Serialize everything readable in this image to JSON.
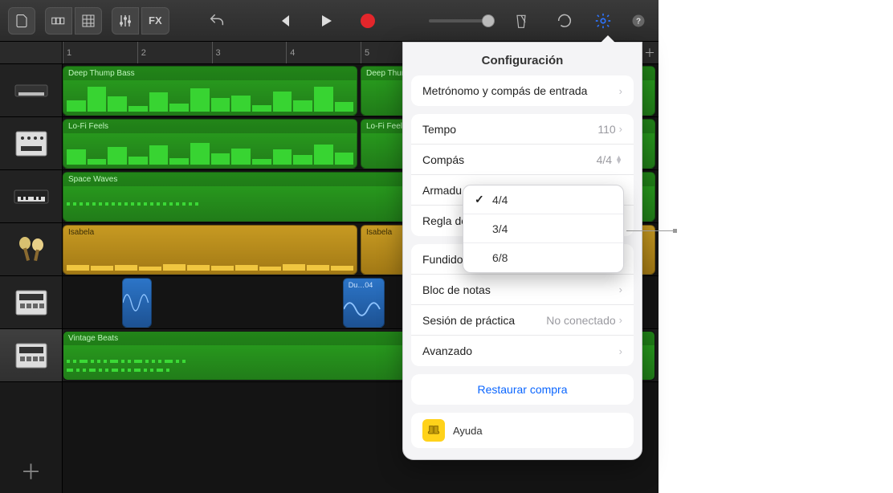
{
  "toolbar": {
    "fx_label": "FX"
  },
  "ruler": {
    "marks": [
      "1",
      "2",
      "3",
      "4",
      "5"
    ]
  },
  "tracks": [
    {
      "name": "Deep Thump Bass",
      "type": "midi-green"
    },
    {
      "name": "Lo-Fi Feels",
      "type": "midi-green"
    },
    {
      "name": "Space Waves",
      "type": "dots-green"
    },
    {
      "name": "Isabela",
      "type": "midi-olive"
    },
    {
      "name": "Du…04",
      "type": "audio-blue"
    },
    {
      "name": "Vintage Beats",
      "type": "dots-green"
    }
  ],
  "popover": {
    "title": "Configuración",
    "metronome": "Metrónomo y compás de entrada",
    "tempo_label": "Tempo",
    "tempo_value": "110",
    "compas_label": "Compás",
    "compas_value": "4/4",
    "armadura_label": "Armadu",
    "regla_label": "Regla de",
    "fundido_label": "Fundido de salida",
    "bloc_label": "Bloc de notas",
    "sesion_label": "Sesión de práctica",
    "sesion_value": "No conectado",
    "avanzado_label": "Avanzado",
    "restore": "Restaurar compra",
    "help": "Ayuda"
  },
  "dropdown": {
    "options": [
      "4/4",
      "3/4",
      "6/8"
    ],
    "selected": "4/4"
  }
}
